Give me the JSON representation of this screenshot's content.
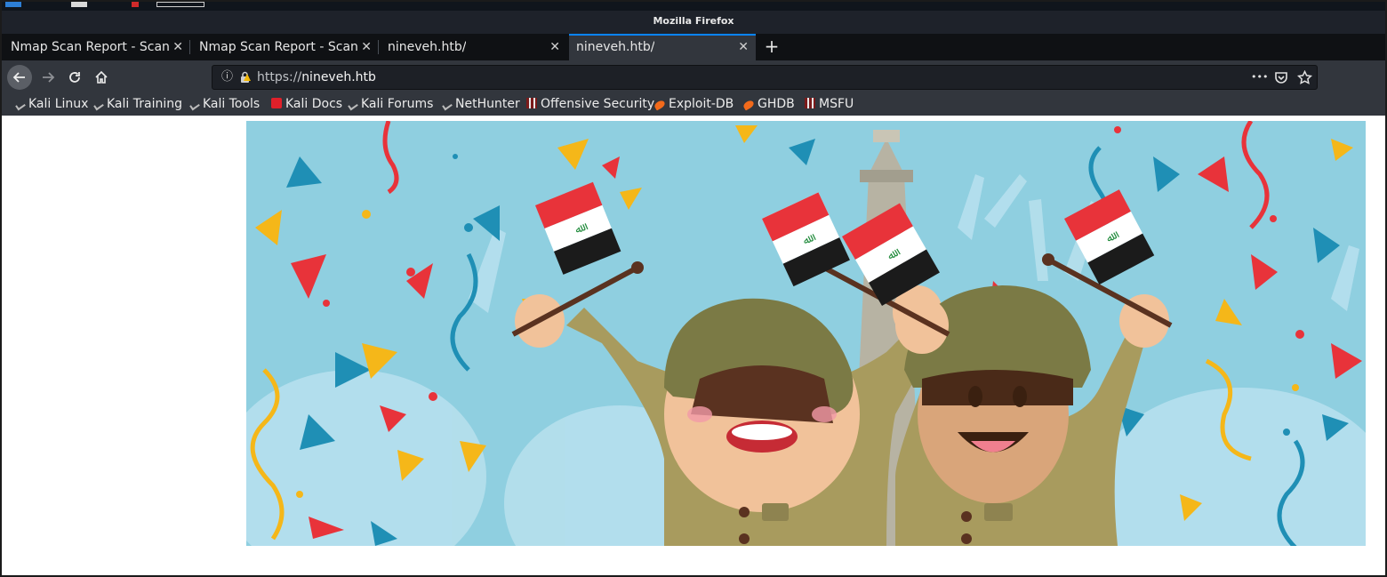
{
  "window": {
    "title": "Mozilla Firefox"
  },
  "tabs": [
    {
      "label": "Nmap Scan Report - Scanned",
      "active": false
    },
    {
      "label": "Nmap Scan Report - Scanned",
      "active": false
    },
    {
      "label": "nineveh.htb/",
      "active": false
    },
    {
      "label": "nineveh.htb/",
      "active": true
    }
  ],
  "tab_close_glyph": "✕",
  "new_tab_glyph": "+",
  "nav": {
    "back_icon": "arrow-left-icon",
    "forward_icon": "arrow-right-icon",
    "reload_icon": "reload-icon",
    "home_icon": "home-icon"
  },
  "urlbar": {
    "scheme": "https://",
    "host": "nineveh.htb",
    "info_glyph": "ⓘ",
    "more_glyph": "•••"
  },
  "bookmarks": [
    {
      "label": "Kali Linux",
      "icon": "kali-dragon-icon"
    },
    {
      "label": "Kali Training",
      "icon": "kali-dragon-icon"
    },
    {
      "label": "Kali Tools",
      "icon": "kali-dragon-icon"
    },
    {
      "label": "Kali Docs",
      "icon": "kali-docs-icon"
    },
    {
      "label": "Kali Forums",
      "icon": "kali-dragon-icon"
    },
    {
      "label": "NetHunter",
      "icon": "kali-dragon-icon"
    },
    {
      "label": "Offensive Security",
      "icon": "offsec-icon"
    },
    {
      "label": "Exploit-DB",
      "icon": "exploit-db-icon"
    },
    {
      "label": "GHDB",
      "icon": "exploit-db-icon"
    },
    {
      "label": "MSFU",
      "icon": "offsec-icon"
    }
  ],
  "colors": {
    "accent": "#0a84ff",
    "sky": "#8fcfe0",
    "flag_red": "#e8333a",
    "flag_green": "#1f8a3a",
    "helmet": "#7b7a45",
    "uniform": "#a89b5e"
  }
}
